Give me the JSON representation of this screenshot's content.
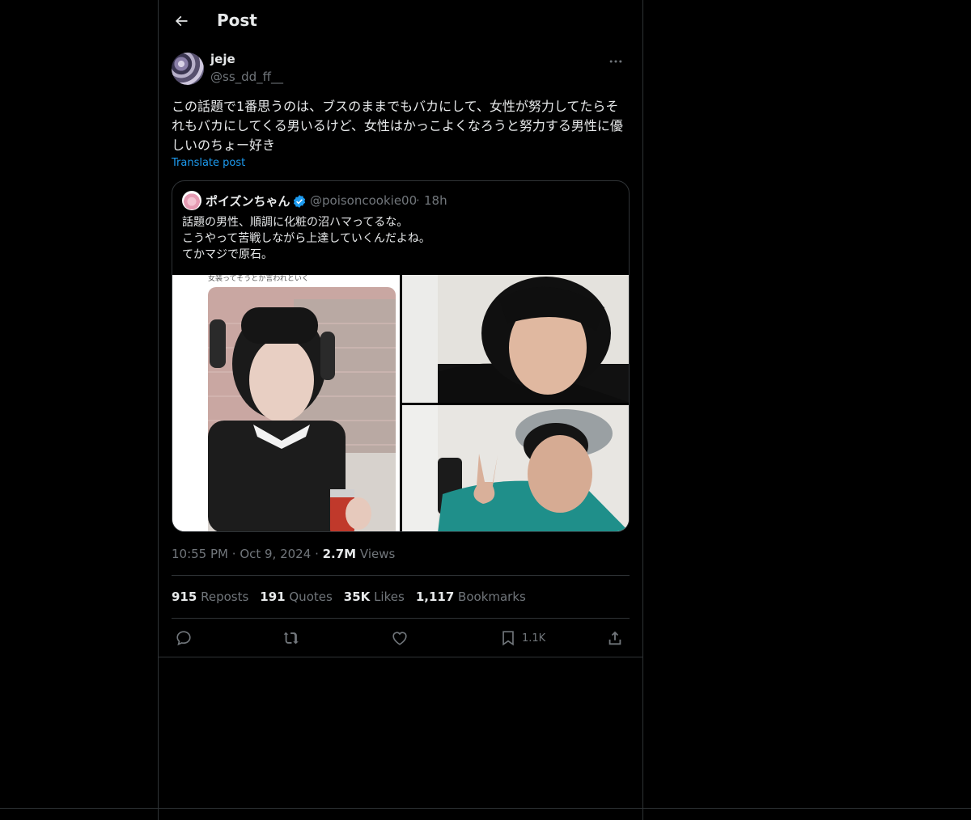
{
  "header": {
    "title": "Post",
    "back_icon": "arrow-left-icon"
  },
  "post": {
    "author": {
      "display_name": "jeje",
      "handle": "@ss_dd_ff__"
    },
    "text": "この話題で1番思うのは、ブスのままでもバカにして、女性が努力してたらそれもバカにしてくる男いるけど、女性はかっこよくなろうと努力する男性に優しいのちょー好き",
    "translate_label": "Translate post",
    "time": "10:55 PM",
    "date": "Oct 9, 2024",
    "views_count": "2.7M",
    "views_label": "Views"
  },
  "quote": {
    "display_name": "ポイズンちゃん",
    "verified_icon": "verified-badge-icon",
    "handle": "@poisoncookie00",
    "separator": "·",
    "age": "18h",
    "text": "話題の男性、順調に化粧の沼ハマってるな。\nこうやって苦戦しながら上達していくんだよね。\nてかマジで原石。",
    "images": [
      "photo-selfie-headphones",
      "photo-selfie-closeup",
      "photo-selfie-peace-sign"
    ],
    "left_photo_caption": "女装ってそうとか言われといく"
  },
  "stats": [
    {
      "count": "915",
      "label": "Reposts"
    },
    {
      "count": "191",
      "label": "Quotes"
    },
    {
      "count": "35K",
      "label": "Likes"
    },
    {
      "count": "1,117",
      "label": "Bookmarks"
    }
  ],
  "actions": {
    "reply": "reply-icon",
    "repost": "repost-icon",
    "like": "like-icon",
    "bookmark_count": "1.1K",
    "share": "share-icon"
  },
  "colors": {
    "background": "#000000",
    "text": "#e7e9ea",
    "muted": "#71767b",
    "accent": "#1d9bf0",
    "border": "#2f3336"
  }
}
